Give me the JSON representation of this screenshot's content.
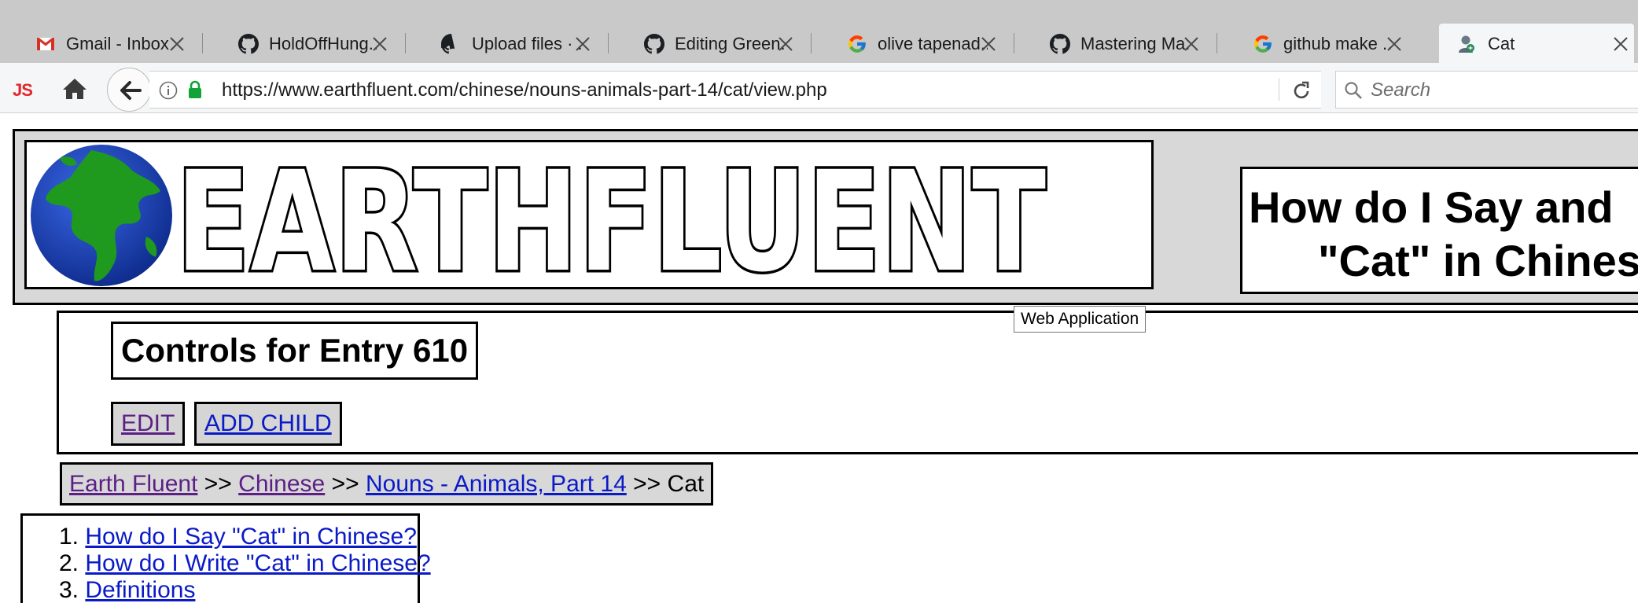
{
  "browser": {
    "tabs": [
      {
        "title": "Gmail - Inbox",
        "icon": "gmail-icon"
      },
      {
        "title": "HoldOffHung...",
        "icon": "github-icon"
      },
      {
        "title": "Upload files · ...",
        "icon": "github-icon"
      },
      {
        "title": "Editing Green...",
        "icon": "github-icon"
      },
      {
        "title": "olive tapenad...",
        "icon": "google-icon"
      },
      {
        "title": "Mastering Ma...",
        "icon": "github-icon"
      },
      {
        "title": "github make ...",
        "icon": "google-icon"
      },
      {
        "title": "Cat",
        "icon": "web-app-icon",
        "active": true
      }
    ],
    "toolbar": {
      "js_label": "JS",
      "url": "https://www.earthfluent.com/chinese/nouns-animals-part-14/cat/view.php",
      "search_placeholder": "Search"
    }
  },
  "page": {
    "logo_text": "EARTHFLUENT",
    "heading": {
      "line1": "How do I Say and",
      "line2": "\"Cat\" in Chines"
    },
    "tooltip": "Web Application",
    "controls": {
      "title": "Controls for Entry 610",
      "edit_label": "EDIT",
      "add_child_label": "ADD CHILD"
    },
    "breadcrumb": {
      "items": [
        "Earth Fluent",
        "Chinese",
        "Nouns - Animals, Part 14"
      ],
      "separator": ">>",
      "current": "Cat"
    },
    "toc": [
      {
        "number": "1.",
        "label": "How do I Say \"Cat\" in Chinese?"
      },
      {
        "number": "2.",
        "label": "How do I Write \"Cat\" in Chinese?"
      },
      {
        "number": "3.",
        "label": "Definitions"
      }
    ]
  },
  "colors": {
    "link_visited": "#5d1f86",
    "link_unvisited": "#0a1ac7",
    "tab_strip": "#c9c9c9",
    "toolbar": "#f5f6f7",
    "header_band": "#d8d8d8",
    "globe_ocean": "#1a3fb5",
    "globe_land": "#1f9a1f"
  }
}
